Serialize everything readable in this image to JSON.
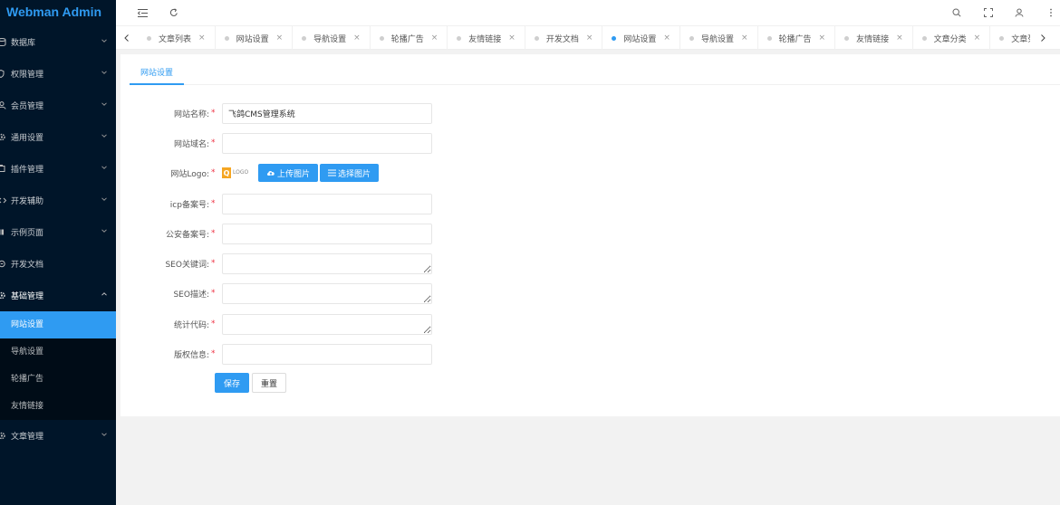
{
  "brand": "Webman Admin",
  "sidebar": {
    "items": [
      {
        "label": "数据库",
        "icon": "database-icon"
      },
      {
        "label": "权限管理",
        "icon": "shield-icon"
      },
      {
        "label": "会员管理",
        "icon": "user-icon"
      },
      {
        "label": "通用设置",
        "icon": "gear-icon"
      },
      {
        "label": "插件管理",
        "icon": "plugin-icon"
      },
      {
        "label": "开发辅助",
        "icon": "code-icon"
      },
      {
        "label": "示例页面",
        "icon": "layout-icon"
      },
      {
        "label": "开发文档",
        "icon": "doc-icon"
      },
      {
        "label": "基础管理",
        "icon": "gear-icon"
      }
    ],
    "open_submenu": [
      "网站设置",
      "导航设置",
      "轮播广告",
      "友情链接"
    ],
    "last_item": {
      "label": "文章管理",
      "icon": "gear-icon"
    }
  },
  "tabs": [
    "文章列表",
    "网站设置",
    "导航设置",
    "轮播广告",
    "友情链接",
    "开发文档",
    "网站设置",
    "导航设置",
    "轮播广告",
    "友情链接",
    "文章分类",
    "文章列表"
  ],
  "active_tab_index": 6,
  "content": {
    "tab_label": "网站设置",
    "form": {
      "site_name_label": "网站名称:",
      "site_name_value": "飞鸽CMS管理系统",
      "site_domain_label": "网站域名:",
      "site_logo_label": "网站Logo:",
      "logo_mark": "Q",
      "logo_text": "LOGO",
      "upload_label": "上传图片",
      "choose_label": "选择图片",
      "icp_label": "icp备案号:",
      "police_label": "公安备案号:",
      "seo_kw_label": "SEO关键词:",
      "seo_desc_label": "SEO描述:",
      "stats_label": "统计代码:",
      "copyright_label": "版权信息:",
      "required_mark": "*",
      "save_label": "保存",
      "reset_label": "重置"
    }
  },
  "colors": {
    "sidebar_bg": "#001529",
    "accent": "#2f9bf2",
    "required": "#ee3344"
  }
}
